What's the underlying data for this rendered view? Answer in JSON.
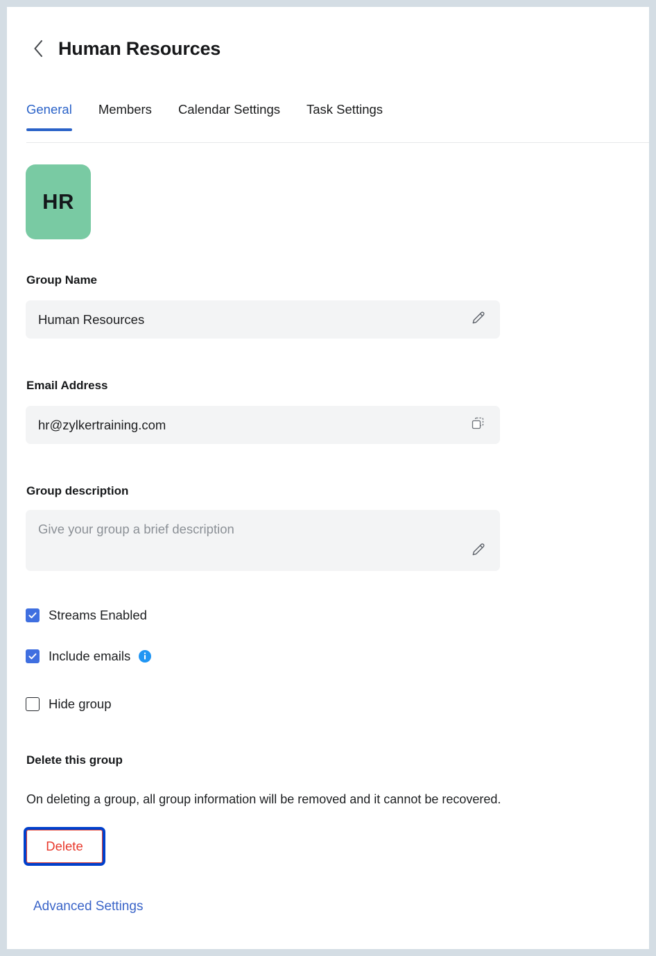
{
  "window": {
    "background_color": "#d4dde4",
    "card_background": "#ffffff"
  },
  "header": {
    "back_icon": "chevron-left-icon",
    "title": "Human Resources"
  },
  "tabs": {
    "active_color": "#2a62c8",
    "items": [
      {
        "label": "General",
        "active": true
      },
      {
        "label": "Members",
        "active": false
      },
      {
        "label": "Calendar Settings",
        "active": false
      },
      {
        "label": "Task Settings",
        "active": false
      }
    ]
  },
  "avatar": {
    "initials": "HR",
    "background_color": "#79caa3",
    "text_color": "#14181b"
  },
  "fields": {
    "group_name": {
      "label": "Group Name",
      "value": "Human Resources",
      "action_icon": "pencil-icon"
    },
    "email_address": {
      "label": "Email Address",
      "value": "hr@zylkertraining.com",
      "action_icon": "copy-icon"
    },
    "group_description": {
      "label": "Group description",
      "value": "",
      "placeholder": "Give your group a brief description",
      "action_icon": "pencil-icon"
    }
  },
  "checkboxes": [
    {
      "label": "Streams Enabled",
      "checked": true,
      "has_info": false
    },
    {
      "label": "Include emails",
      "checked": true,
      "has_info": true,
      "info_icon": "info-icon"
    },
    {
      "label": "Hide group",
      "checked": false,
      "has_info": false
    }
  ],
  "checkbox_checked_color": "#3f6fe0",
  "delete_section": {
    "heading": "Delete this group",
    "description": "On deleting a group, all group information will be removed and it cannot be recovered.",
    "button_label": "Delete",
    "button_text_color": "#e8382b",
    "button_highlight_color": "#0040cc"
  },
  "footer": {
    "advanced_settings_label": "Advanced Settings",
    "link_color": "#3a64c8"
  }
}
